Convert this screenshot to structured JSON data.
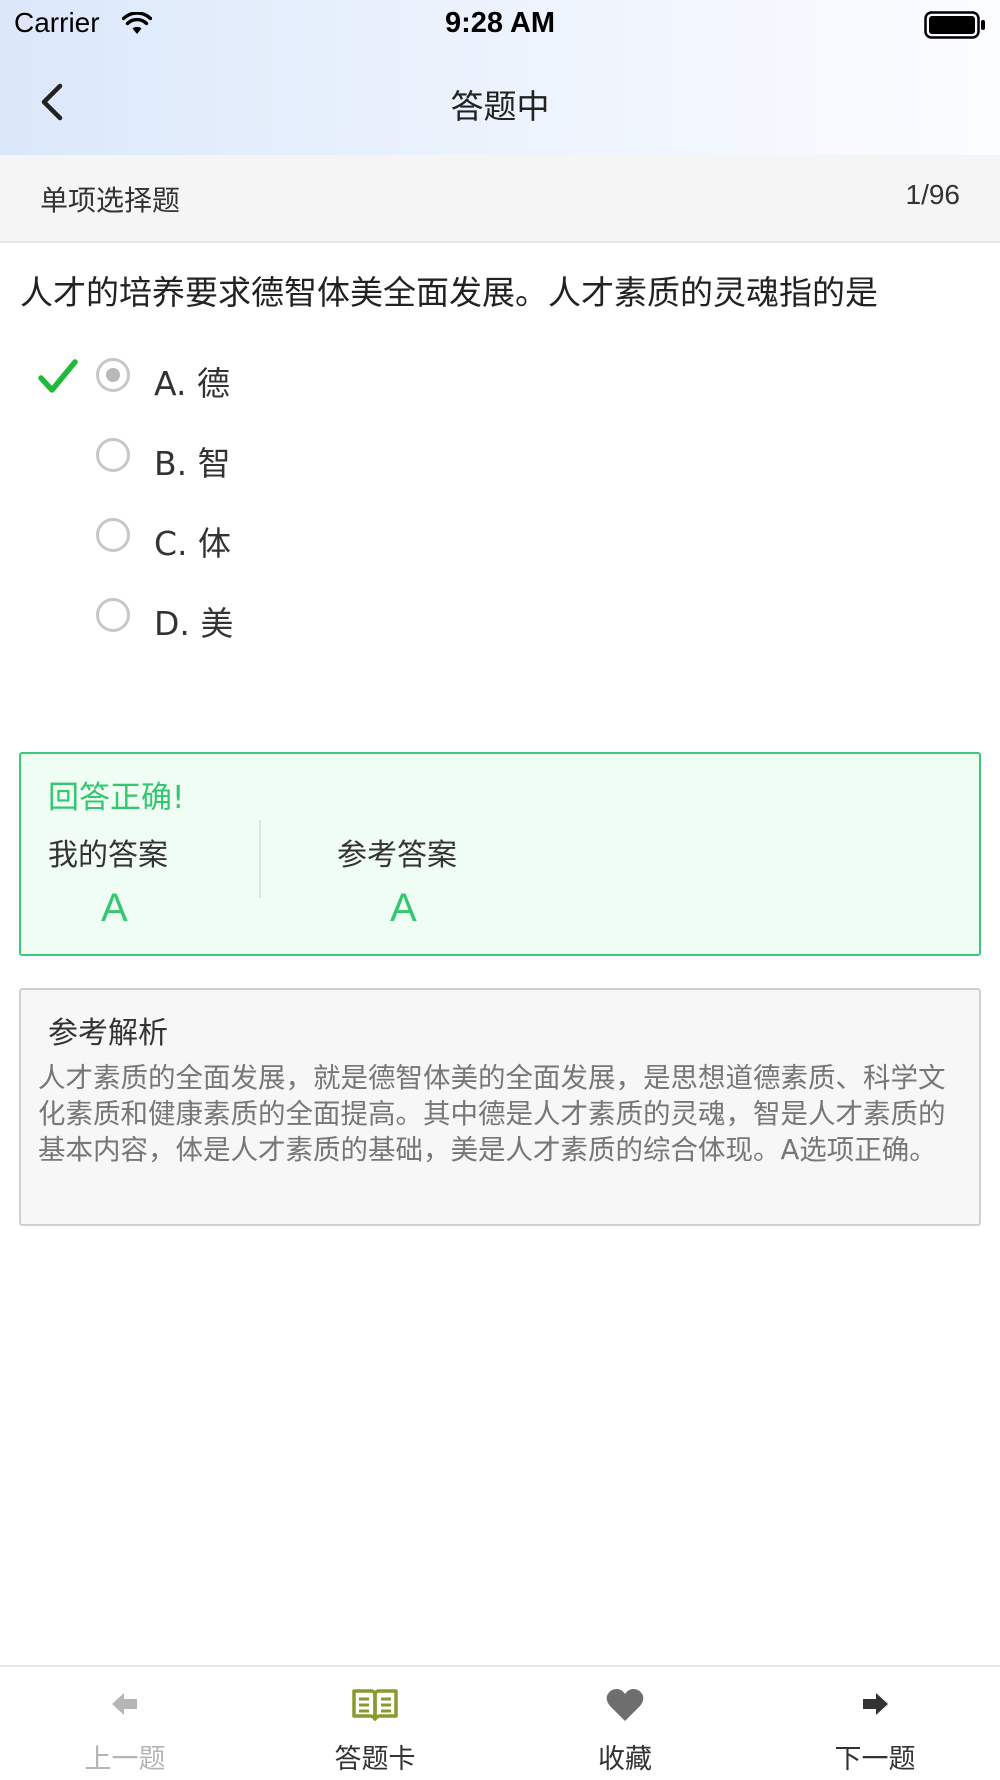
{
  "status_bar": {
    "carrier": "Carrier",
    "time": "9:28 AM"
  },
  "nav": {
    "title": "答题中",
    "back_icon": "chevron-left-icon"
  },
  "question_meta": {
    "type": "单项选择题",
    "index": "1/96"
  },
  "question": {
    "text": "人才的培养要求德智体美全面发展。人才素质的灵魂指的是",
    "options": [
      {
        "label": "A. 德",
        "selected": true,
        "correct_mark": true
      },
      {
        "label": "B. 智",
        "selected": false,
        "correct_mark": false
      },
      {
        "label": "C. 体",
        "selected": false,
        "correct_mark": false
      },
      {
        "label": "D. 美",
        "selected": false,
        "correct_mark": false
      }
    ]
  },
  "result": {
    "title": "回答正确!",
    "my_answer_label": "我的答案",
    "my_answer": "A",
    "ref_answer_label": "参考答案",
    "ref_answer": "A"
  },
  "analysis": {
    "title": "参考解析",
    "text": "人才素质的全面发展，就是德智体美的全面发展，是思想道德素质、科学文化素质和健康素质的全面提高。其中德是人才素质的灵魂，智是人才素质的基本内容，体是人才素质的基础，美是人才素质的综合体现。A选项正确。"
  },
  "tab_bar": {
    "items": [
      {
        "label": "上一题",
        "icon": "arrow-left-icon",
        "enabled": false
      },
      {
        "label": "答题卡",
        "icon": "book-icon",
        "enabled": true
      },
      {
        "label": "收藏",
        "icon": "heart-icon",
        "enabled": true
      },
      {
        "label": "下一题",
        "icon": "arrow-right-icon",
        "enabled": true
      }
    ]
  },
  "colors": {
    "correct_green": "#35c76f",
    "book_icon_green": "#8a9a2e",
    "disabled_gray": "#b5b5b5",
    "dark_icon": "#333333"
  }
}
